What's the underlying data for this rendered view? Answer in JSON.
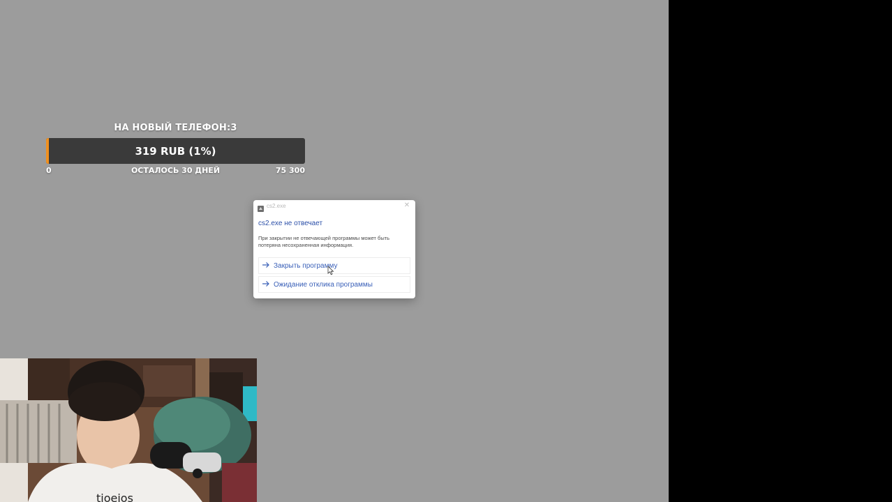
{
  "goal": {
    "title": "НА НОВЫЙ ТЕЛЕФОН:3",
    "progress_label": "319 RUB (1%)",
    "progress_fraction": 0.01,
    "min_label": "0",
    "remaining_label": "ОСТАЛОСЬ 30 ДНЕЙ",
    "max_label": "75 300",
    "fill_color": "#f0901f",
    "bar_color": "#3a3a3a"
  },
  "dialog": {
    "app_name": "cs2.exe",
    "heading": "cs2.exe не отвечает",
    "body": "При закрытии не отвечающей программы может быть потеряна несохраненная информация.",
    "options": [
      {
        "label": "Закрыть программу",
        "icon": "arrow-right-icon"
      },
      {
        "label": "Ожидание отклика программы",
        "icon": "arrow-right-icon"
      }
    ],
    "close_icon": "close-icon"
  },
  "webcam": {
    "icon": "webcam-feed"
  },
  "colors": {
    "stage_background": "#9c9c9c",
    "sidebar_black": "#000000",
    "dialog_link": "#3a60b8"
  }
}
